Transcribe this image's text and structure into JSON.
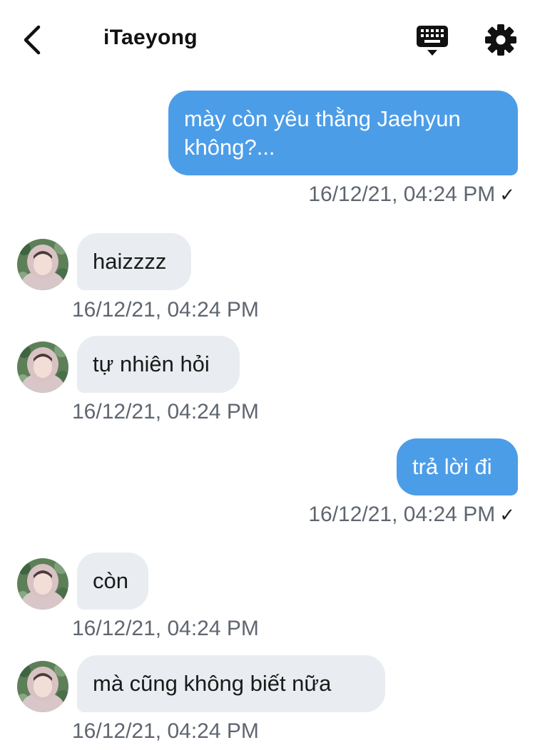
{
  "header": {
    "title": "iTaeyong",
    "back_icon": "chevron-left-icon",
    "keyboard_icon": "keyboard-icon",
    "settings_icon": "gear-icon"
  },
  "colors": {
    "outgoing_bubble": "#4c9de8",
    "incoming_bubble": "#e9ecf0",
    "timestamp": "#5f6670"
  },
  "messages": [
    {
      "direction": "out",
      "text": "mày còn yêu thằng Jaehyun không?...",
      "line1": "mày còn yêu thằng Jaehyun",
      "line2": "không?...",
      "time": "16/12/21, 04:24 PM",
      "status": "✓"
    },
    {
      "direction": "in",
      "text": "haizzzz",
      "time": "16/12/21, 04:24 PM"
    },
    {
      "direction": "in",
      "text": "tự nhiên hỏi",
      "time": "16/12/21, 04:24 PM"
    },
    {
      "direction": "out",
      "text": "trả lời đi",
      "time": "16/12/21, 04:24 PM",
      "status": "✓"
    },
    {
      "direction": "in",
      "text": "còn",
      "time": "16/12/21, 04:24 PM"
    },
    {
      "direction": "in",
      "text": "mà cũng không biết nữa",
      "time": "16/12/21, 04:24 PM"
    }
  ]
}
